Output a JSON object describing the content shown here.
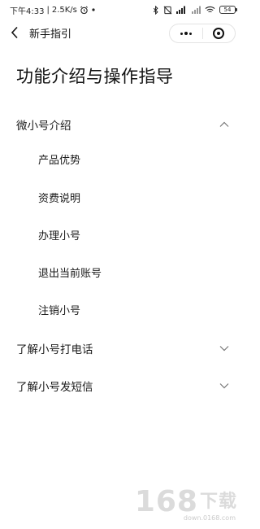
{
  "status_bar": {
    "time": "下午4:33",
    "separator": "|",
    "net_speed": "2.5K/s",
    "battery": "54"
  },
  "nav": {
    "title": "新手指引"
  },
  "page": {
    "title": "功能介绍与操作指导"
  },
  "sections": [
    {
      "label": "微小号介绍",
      "expanded": true,
      "items": [
        "产品优势",
        "资费说明",
        "办理小号",
        "退出当前账号",
        "注销小号"
      ]
    },
    {
      "label": "了解小号打电话",
      "expanded": false
    },
    {
      "label": "了解小号发短信",
      "expanded": false
    }
  ],
  "watermark": {
    "digits": "168",
    "cn": "下载",
    "url": "down.0168.com"
  }
}
